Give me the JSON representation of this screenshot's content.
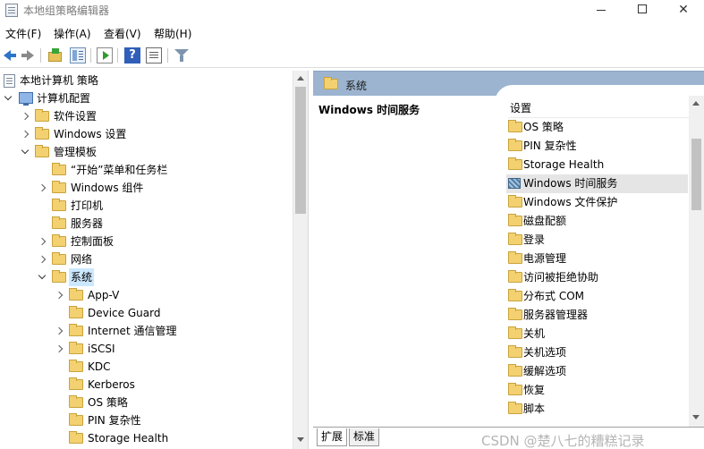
{
  "window": {
    "title": "本地组策略编辑器",
    "min_icon": "minimize-icon",
    "max_icon": "maximize-icon",
    "close_glyph": "✕"
  },
  "menu": [
    "文件(F)",
    "操作(A)",
    "查看(V)",
    "帮助(H)"
  ],
  "toolbar": {
    "icons": [
      "back-arrow-icon",
      "forward-arrow-icon",
      "up-folder-icon",
      "show-hide-tree-icon",
      "export-list-icon",
      "help-icon",
      "properties-icon",
      "filter-icon"
    ],
    "help_glyph": "?"
  },
  "tree": {
    "root": "本地计算机 策略",
    "computer_config": "计算机配置",
    "software_settings": "软件设置",
    "windows_settings": "Windows 设置",
    "admin_templates": "管理模板",
    "start_menu": "“开始”菜单和任务栏",
    "windows_components": "Windows 组件",
    "printers": "打印机",
    "server": "服务器",
    "control_panel": "控制面板",
    "network": "网络",
    "system": "系统",
    "appv": "App-V",
    "device_guard": "Device Guard",
    "internet_comm": "Internet 通信管理",
    "iscsi": "iSCSI",
    "kdc": "KDC",
    "kerberos": "Kerberos",
    "os_policy": "OS 策略",
    "pin_complexity": "PIN 复杂性",
    "storage_health": "Storage Health"
  },
  "right": {
    "header": "系统",
    "description_title": "Windows 时间服务",
    "column_header": "设置",
    "items": [
      "OS 策略",
      "PIN 复杂性",
      "Storage Health",
      "Windows 时间服务",
      "Windows 文件保护",
      "磁盘配额",
      "登录",
      "电源管理",
      "访问被拒绝协助",
      "分布式 COM",
      "服务器管理器",
      "关机",
      "关机选项",
      "缓解选项",
      "恢复",
      "脚本"
    ]
  },
  "tabs": [
    "扩展",
    "标准"
  ],
  "watermark": "CSDN @楚八七的糟糕记录"
}
